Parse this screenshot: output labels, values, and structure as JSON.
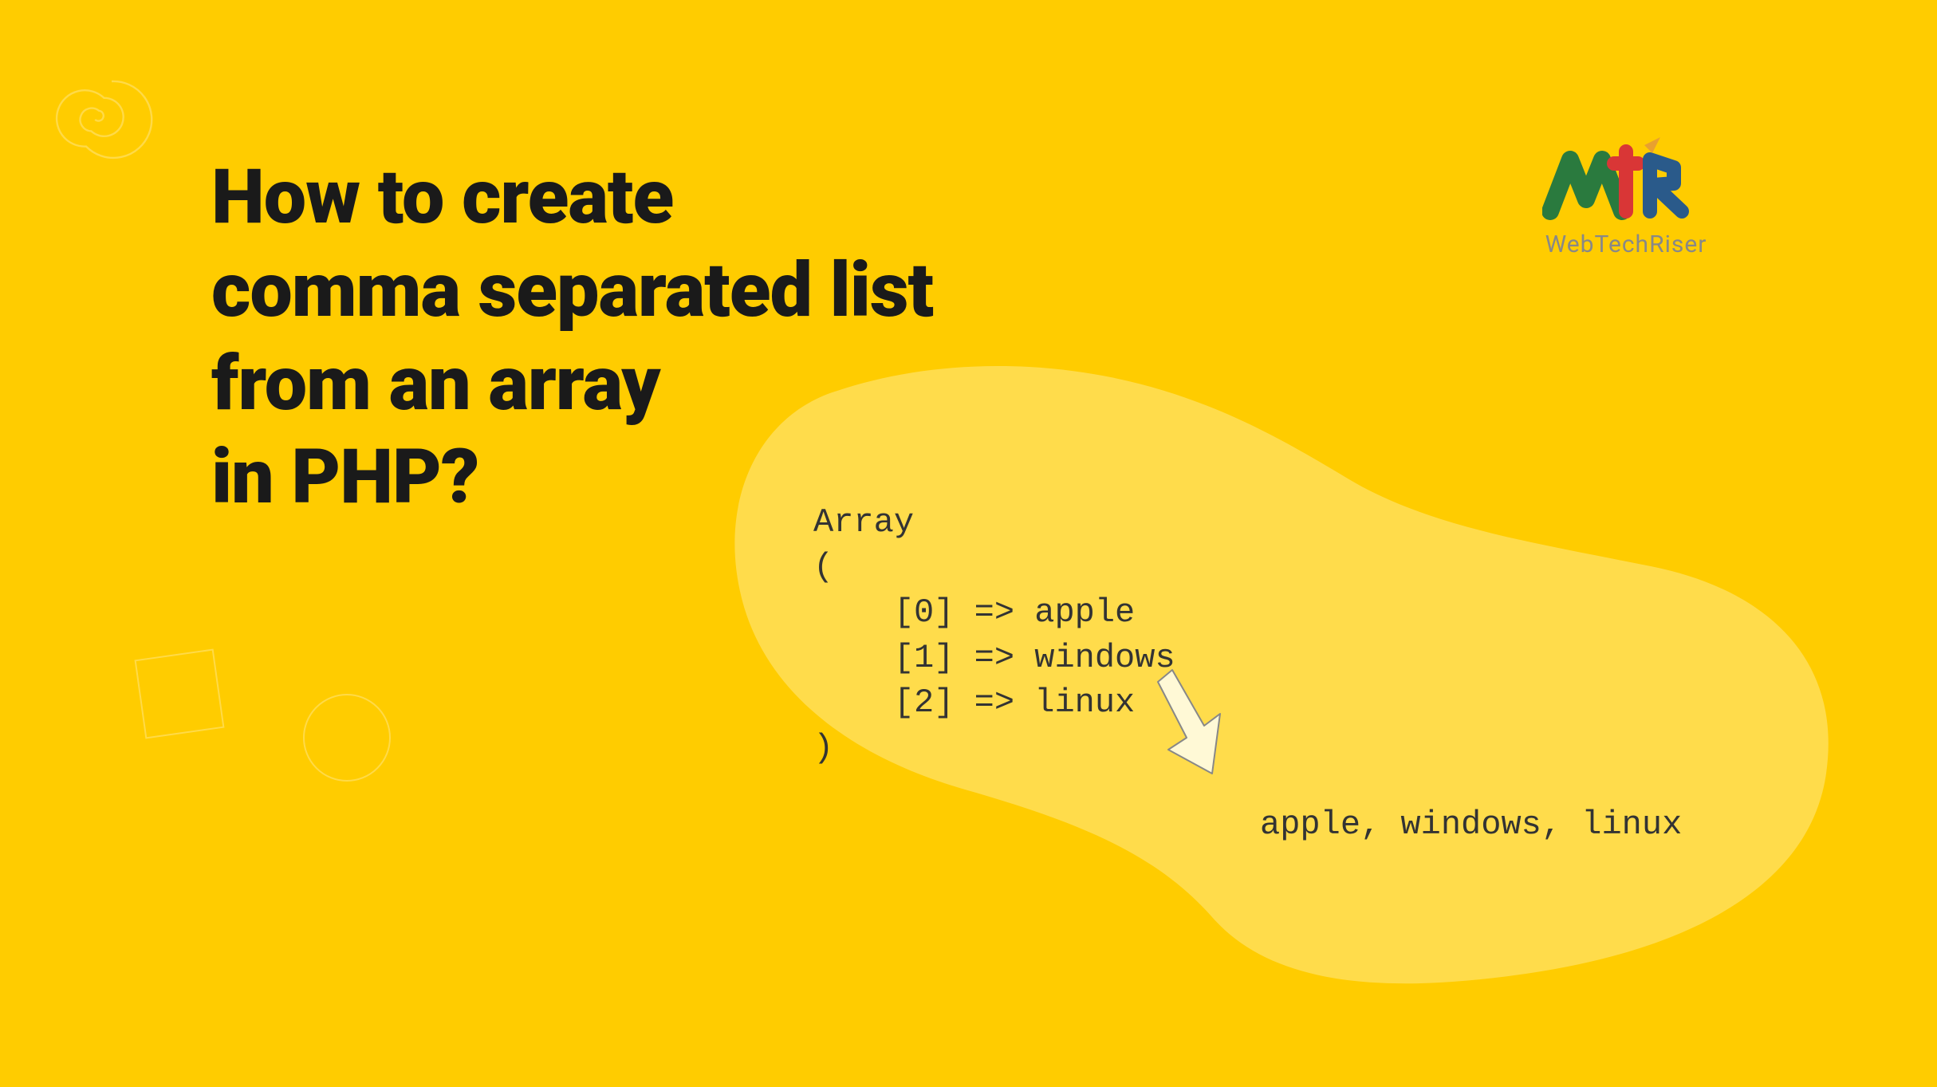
{
  "title": {
    "line1": "How to create",
    "line2": "comma separated list",
    "line3": "from an array",
    "line4": "in PHP?"
  },
  "logo": {
    "name": "WebTechRiser"
  },
  "code": {
    "line1": "Array",
    "line2": "(",
    "line3": "    [0] => apple",
    "line4": "    [1] => windows",
    "line5": "    [2] => linux",
    "line6": ")"
  },
  "output": "apple, windows, linux"
}
